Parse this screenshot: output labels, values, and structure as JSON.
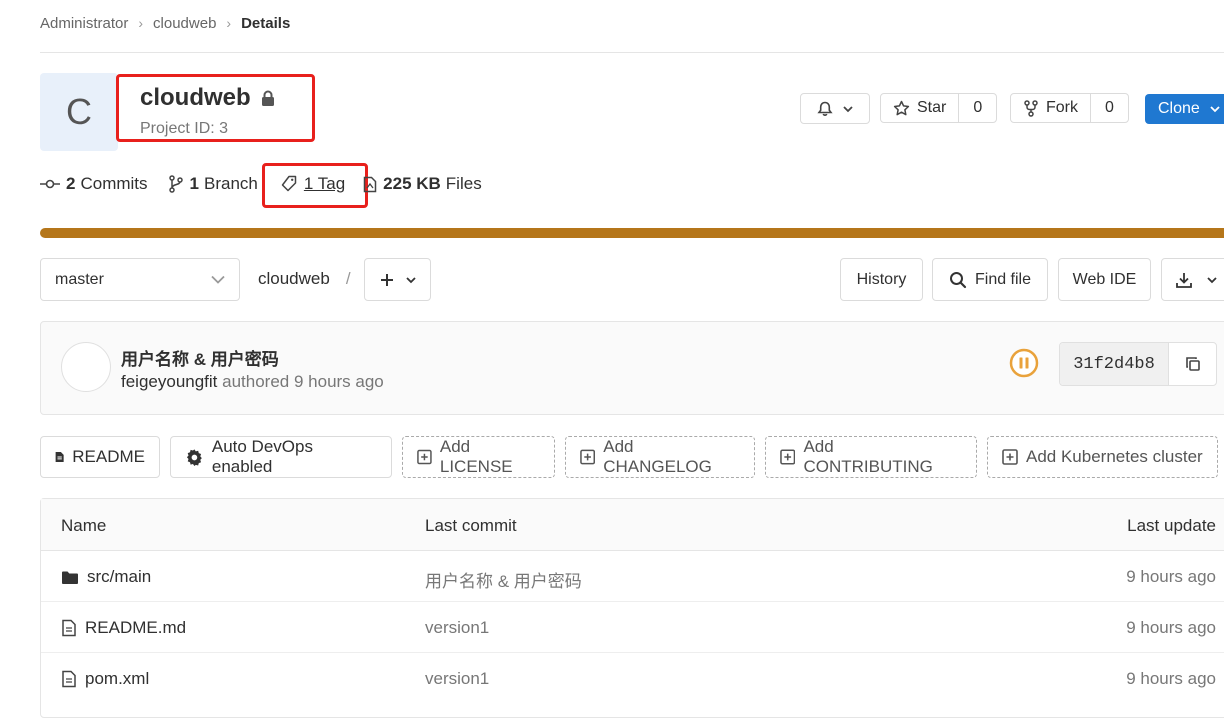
{
  "breadcrumb": [
    "Administrator",
    "cloudweb",
    "Details"
  ],
  "project": {
    "avatar_letter": "C",
    "name": "cloudweb",
    "project_id": "Project ID: 3"
  },
  "header_buttons": {
    "star_label": "Star",
    "star_count": "0",
    "fork_label": "Fork",
    "fork_count": "0",
    "clone_label": "Clone"
  },
  "stats": {
    "commits_count": "2",
    "commits_label": "Commits",
    "branch_count": "1",
    "branch_label": "Branch",
    "tag_label": "1 Tag",
    "files_size": "225 KB",
    "files_label": "Files"
  },
  "repository_language_color": "#b5761a",
  "toolbar": {
    "branch": "master",
    "path_root": "cloudweb",
    "path_sep": "/",
    "history": "History",
    "find_file": "Find file",
    "web_ide": "Web IDE"
  },
  "last_commit": {
    "title": "用户名称 & 用户密码",
    "author": "feigeyoungfit",
    "meta": "authored 9 hours ago",
    "pipeline_status": "paused",
    "sha": "31f2d4b8"
  },
  "quick_links": {
    "readme": "README",
    "auto_devops": "Auto DevOps enabled",
    "add_license": "Add LICENSE",
    "add_changelog": "Add CHANGELOG",
    "add_contributing": "Add CONTRIBUTING",
    "add_kubernetes": "Add Kubernetes cluster"
  },
  "file_table": {
    "headers": {
      "name": "Name",
      "last_commit": "Last commit",
      "last_update": "Last update"
    },
    "rows": [
      {
        "name": "src/main",
        "type": "folder",
        "commit": "用户名称 & 用户密码",
        "update": "9 hours ago"
      },
      {
        "name": "README.md",
        "type": "file",
        "commit": "version1",
        "update": "9 hours ago"
      },
      {
        "name": "pom.xml",
        "type": "file",
        "commit": "version1",
        "update": "9 hours ago"
      }
    ]
  }
}
